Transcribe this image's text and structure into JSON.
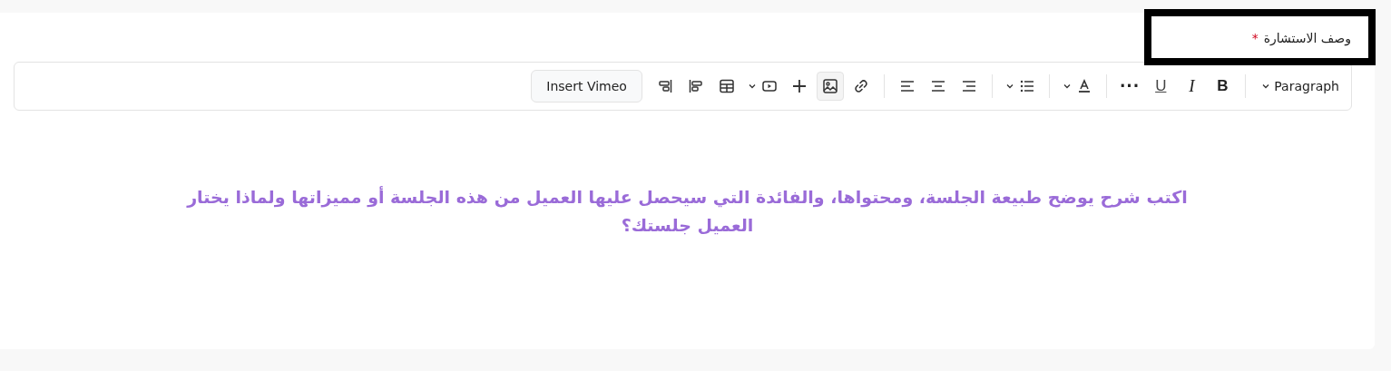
{
  "field": {
    "label": "وصف الاستشارة",
    "required_mark": "*",
    "highlighted": true
  },
  "toolbar": {
    "items": [
      {
        "kind": "block-format",
        "label": "Paragraph",
        "has_menu": true
      },
      {
        "kind": "divider"
      },
      {
        "kind": "bold",
        "label": "B",
        "active": false
      },
      {
        "kind": "italic",
        "label": "I",
        "active": false
      },
      {
        "kind": "underline",
        "label": "U",
        "active": false
      },
      {
        "kind": "more",
        "label": "···",
        "active": false
      },
      {
        "kind": "divider"
      },
      {
        "kind": "text-color",
        "active": false,
        "has_menu": true
      },
      {
        "kind": "divider"
      },
      {
        "kind": "bullet-list",
        "active": false,
        "has_menu": true
      },
      {
        "kind": "divider"
      },
      {
        "kind": "align-right",
        "active": false
      },
      {
        "kind": "align-center",
        "active": false
      },
      {
        "kind": "align-left",
        "active": false
      },
      {
        "kind": "divider"
      },
      {
        "kind": "link",
        "active": false
      },
      {
        "kind": "image",
        "active": true
      },
      {
        "kind": "plus",
        "active": false
      },
      {
        "kind": "video",
        "active": false,
        "has_menu": true
      },
      {
        "kind": "table",
        "active": false
      },
      {
        "kind": "align-block-left",
        "active": false
      },
      {
        "kind": "align-block-right",
        "active": false
      },
      {
        "kind": "text-button",
        "label": "Insert Vimeo"
      }
    ]
  },
  "editor": {
    "placeholder": "اكتب شرح يوضح طبيعة الجلسة، ومحتواها، والفائدة التي سيحصل عليها العميل من هذه الجلسة أو مميزاتها ولماذا يختار العميل جلستك؟"
  }
}
